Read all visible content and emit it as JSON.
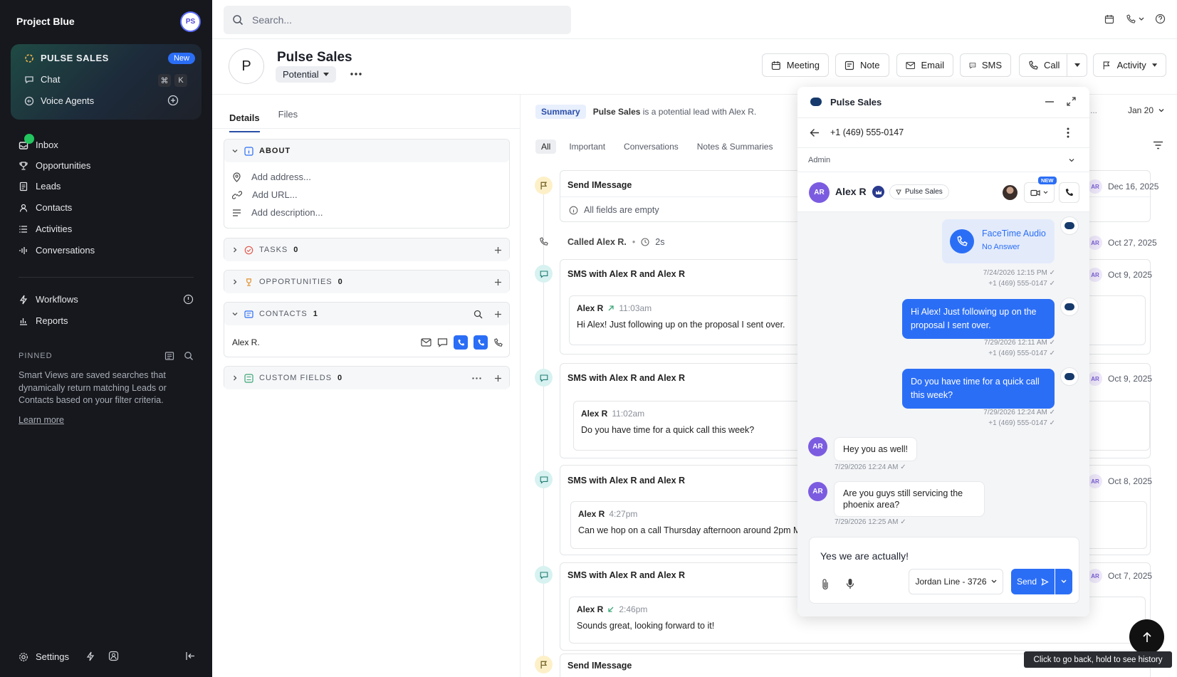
{
  "sidebar": {
    "workspace": "Project Blue",
    "avatar": "PS",
    "card": {
      "pulse_sales": "PULSE SALES",
      "new_badge": "New",
      "chat": "Chat",
      "kbd_cmd": "⌘",
      "kbd_k": "K",
      "voice_agents": "Voice Agents"
    },
    "nav": [
      "Inbox",
      "Opportunities",
      "Leads",
      "Contacts",
      "Activities",
      "Conversations"
    ],
    "workflows": "Workflows",
    "reports": "Reports",
    "pinned": "PINNED",
    "smart_views_text": "Smart Views are saved searches that dynamically return matching Leads or Contacts based on your filter criteria.",
    "learn_more": "Learn more",
    "settings": "Settings"
  },
  "search": {
    "placeholder": "Search..."
  },
  "header": {
    "avatar_letter": "P",
    "title": "Pulse Sales",
    "status": "Potential",
    "buttons": {
      "meeting": "Meeting",
      "note": "Note",
      "email": "Email",
      "sms": "SMS",
      "call": "Call",
      "activity": "Activity"
    }
  },
  "details": {
    "tabs": [
      "Details",
      "Files"
    ],
    "about": "ABOUT",
    "add_address": "Add address...",
    "add_url": "Add URL...",
    "add_description": "Add description...",
    "tasks": "TASKS",
    "tasks_count": "0",
    "opportunities": "OPPORTUNITIES",
    "opportunities_count": "0",
    "contacts": "CONTACTS",
    "contacts_count": "1",
    "contact_name": "Alex R.",
    "custom_fields": "CUSTOM FIELDS",
    "custom_fields_count": "0"
  },
  "feed": {
    "summary_pill": "Summary",
    "summary_bold": "Pulse Sales",
    "summary_text": "is a potential lead with Alex R.",
    "summary_ellipsis": "...",
    "date_filter": "Jan 20",
    "filters": [
      "All",
      "Important",
      "Conversations",
      "Notes & Summaries"
    ],
    "events": [
      {
        "title": "Send IMessage",
        "sub": "All fields are empty",
        "date": "Dec 16, 2025"
      },
      {
        "title": "Called Alex R.",
        "duration": "2s",
        "date": "Oct 27, 2025"
      },
      {
        "title": "SMS with Alex R and Alex R",
        "sender": "Alex R",
        "time": "11:03am",
        "text": "Hi Alex! Just following up on the proposal I sent over.",
        "date": "Oct 9, 2025"
      },
      {
        "title": "SMS with Alex R and Alex R",
        "sender": "Alex R",
        "time": "11:02am",
        "text": "Do you have time for a quick call this week?",
        "date": "Oct 9, 2025"
      },
      {
        "title": "SMS with Alex R and Alex R",
        "sender": "Alex R",
        "time": "4:27pm",
        "text": "Can we hop on a call Thursday afternoon around 2pm MS",
        "date": "Oct 8, 2025"
      },
      {
        "title": "SMS with Alex R and Alex R",
        "sender": "Alex R",
        "time": "2:46pm",
        "text": "Sounds great, looking forward to it!",
        "date": "Oct 7, 2025"
      },
      {
        "title": "Send IMessage"
      }
    ],
    "ar": "AR"
  },
  "chat": {
    "title": "Pulse Sales",
    "phone": "+1 (469) 555-0147",
    "admin": "Admin",
    "contact_avatar": "AR",
    "contact_name": "Alex R",
    "tag": "Pulse Sales",
    "new_badge": "NEW",
    "facetime_title": "FaceTime Audio",
    "facetime_sub": "No Answer",
    "msgs": [
      {
        "time": "7/24/2026 12:15 PM",
        "from": "+1 (469) 555-0147"
      },
      {
        "text": "Hi Alex! Just following up on the proposal I sent over.",
        "time": "7/29/2026 12:11 AM",
        "from": "+1 (469) 555-0147"
      },
      {
        "text": "Do you have time for a quick call this week?",
        "time": "7/29/2026 12:24 AM",
        "from": "+1 (469) 555-0147"
      },
      {
        "text": "Hey you as well!",
        "time": "7/29/2026 12:24 AM"
      },
      {
        "text": "Are you guys still servicing the phoenix area?",
        "time": "7/29/2026 12:25 AM"
      }
    ],
    "compose_text": "Yes we are actually!",
    "line": "Jordan Line - 3726",
    "send": "Send"
  },
  "tooltip": "Click to go back, hold to see history",
  "colors": {
    "accent": "#2b6ef6",
    "sidebar_bg": "#16181d",
    "online": "#22c55e",
    "avatar_purple": "#7b5ce0"
  }
}
